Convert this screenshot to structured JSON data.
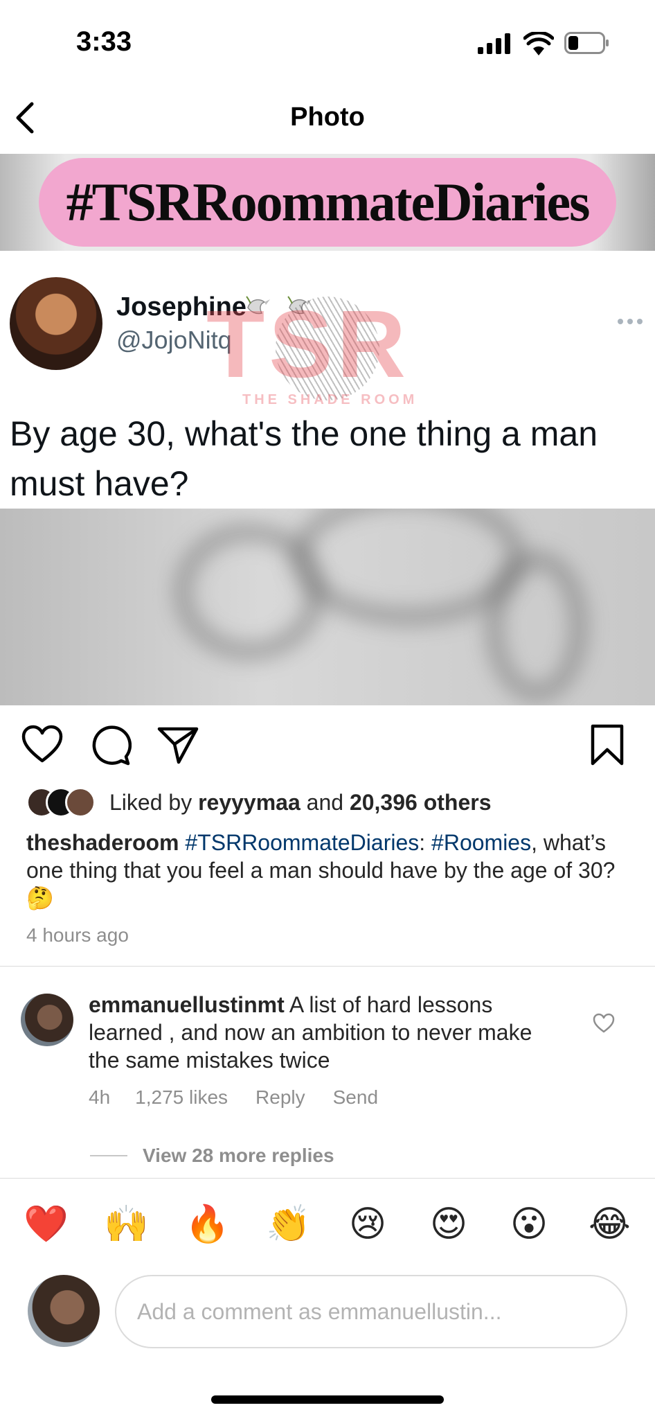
{
  "status_bar": {
    "time": "3:33",
    "icons": [
      "signal-icon",
      "wifi-icon",
      "battery-icon"
    ]
  },
  "nav": {
    "title": "Photo",
    "back_icon": "chevron-left-icon"
  },
  "post_image": {
    "hashtag_banner": "#TSRRoommateDiaries",
    "tweet": {
      "name": "Josephine",
      "handle": "@JojoNitq",
      "text": "By age 30, what's the one thing a man must have?"
    },
    "watermark": {
      "logo": "TSR",
      "tagline": "THE SHADE ROOM"
    }
  },
  "actions": {
    "icons": [
      "heart-icon",
      "comment-icon",
      "share-icon",
      "bookmark-icon"
    ]
  },
  "likes": {
    "prefix": "Liked by ",
    "user": "reyyymaa",
    "middle": " and ",
    "count": "20,396 others"
  },
  "caption": {
    "user": "theshaderoom",
    "hashtag1": "#TSRRoommateDiaries",
    "colon": ": ",
    "hashtag2": "#Roomies",
    "text": ", what’s one thing that you feel a man should have by the age of 30?",
    "emoji": "🤔",
    "time_ago": "4 hours ago"
  },
  "comment": {
    "user": "emmanuellustinmt",
    "text": " A list of hard lessons learned , and now an ambition to never make the same mistakes twice",
    "time": "4h",
    "likes": "1,275 likes",
    "reply": "Reply",
    "send": "Send",
    "view_replies": "View 28 more replies"
  },
  "emoji_bar": [
    "❤️",
    "🙌",
    "🔥",
    "👏",
    "😢",
    "😍",
    "😮",
    "😂"
  ],
  "comment_input": {
    "placeholder": "Add a comment as emmanuellustin..."
  },
  "colors": {
    "hashtag_pill": "#f2a7cf",
    "link": "#00376b",
    "muted": "#8e8e8e"
  }
}
